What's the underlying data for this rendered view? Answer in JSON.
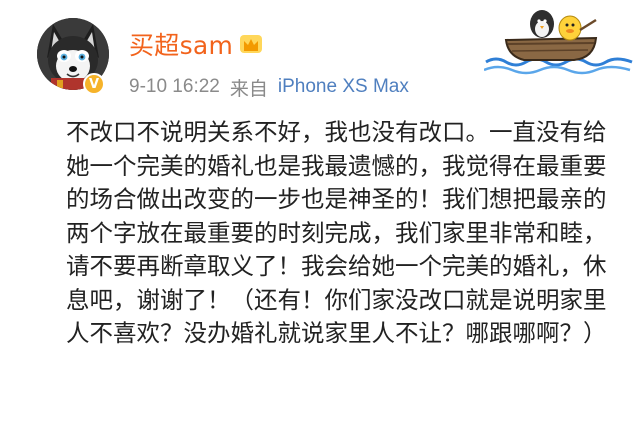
{
  "post": {
    "author": {
      "name": "买超sam",
      "badge_icon": "crown-icon",
      "verified_icon": "verified-v-icon",
      "verified_mark": "V",
      "name_color": "#f2631c"
    },
    "meta": {
      "time": "9-10 16:22",
      "via": "来自",
      "device": "iPhone XS Max",
      "device_color": "#4f7fbf"
    },
    "body": "不改口不说明关系不好，我也没有改口。一直没有给她一个完美的婚礼也是我最遗憾的，我觉得在最重要的场合做出改变的一步也是神圣的！我们想把最亲的两个字放在最重要的时刻完成，我们家里非常和睦，请不要再断章取义了！我会给她一个完美的婚礼，休息吧，谢谢了！（还有！你们家没改口就是说明家里人不喜欢？没办婚礼就说家里人不让？哪跟哪啊？）"
  }
}
